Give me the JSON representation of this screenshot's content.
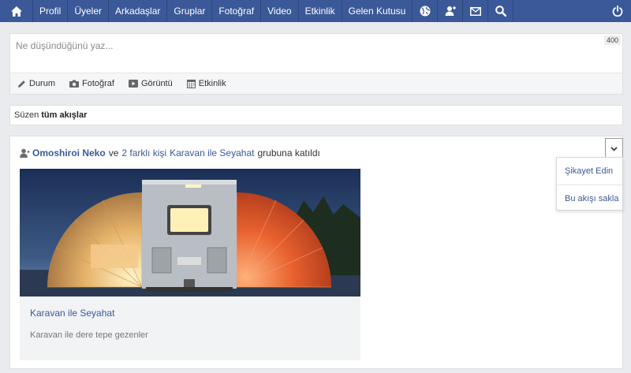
{
  "nav": {
    "items": [
      {
        "label": "Profil"
      },
      {
        "label": "Üyeler"
      },
      {
        "label": "Arkadaşlar"
      },
      {
        "label": "Gruplar"
      },
      {
        "label": "Fotoğraf"
      },
      {
        "label": "Video"
      },
      {
        "label": "Etkinlik"
      },
      {
        "label": "Gelen Kutusu"
      }
    ],
    "icons": [
      "globe-icon",
      "friend-request-icon",
      "mail-icon",
      "search-icon",
      "power-icon"
    ],
    "bar_color": "#3b5998"
  },
  "composer": {
    "placeholder": "Ne düşündüğünü yaz...",
    "counter": "400",
    "actions": [
      {
        "label": "Durum",
        "icon": "pencil-icon"
      },
      {
        "label": "Fotoğraf",
        "icon": "camera-icon"
      },
      {
        "label": "Görüntü",
        "icon": "video-icon"
      },
      {
        "label": "Etkinlik",
        "icon": "calendar-icon"
      }
    ]
  },
  "filter": {
    "prefix": "Süzen",
    "value": "tüm akışlar"
  },
  "post": {
    "user": "Omoshiroi Neko",
    "conj": "ve",
    "others": "2 farklı kişi",
    "group": "Karavan ile Seyahat",
    "action": "grubuna katıldı",
    "card": {
      "title": "Karavan ile Seyahat",
      "description": "Karavan ile dere tepe gezenler"
    }
  },
  "menu": {
    "items": [
      {
        "label": "Şikayet Edin"
      },
      {
        "label": "Bu akışı sakla"
      }
    ]
  }
}
